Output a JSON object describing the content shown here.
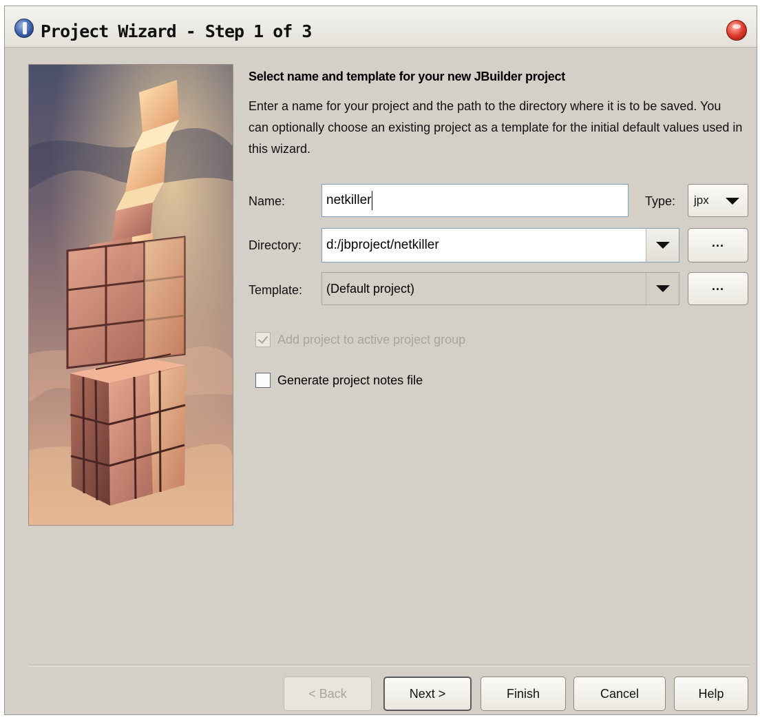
{
  "window": {
    "title": "Project Wizard - Step 1 of 3"
  },
  "icons": {
    "app": "jbuilder-icon",
    "close": "close-icon"
  },
  "heading": "Select name and template for your new JBuilder project",
  "description": "Enter a name for your project and the path to the directory where it is to be saved. You can optionally choose an existing project as a template for the initial default values used in this wizard.",
  "form": {
    "name": {
      "label": "Name:",
      "value": "netkiller"
    },
    "type": {
      "label": "Type:",
      "value": "jpx"
    },
    "directory": {
      "label": "Directory:",
      "value": "d:/jbproject/netkiller"
    },
    "template": {
      "label": "Template:",
      "value": "(Default project)"
    },
    "browse_label": "..."
  },
  "options": {
    "add_to_group": {
      "label": "Add project to active project group",
      "checked": true,
      "enabled": false
    },
    "generate_notes": {
      "label": "Generate project notes file",
      "checked": false,
      "enabled": true
    }
  },
  "buttons": {
    "back": "< Back",
    "next": "Next >",
    "finish": "Finish",
    "cancel": "Cancel",
    "help": "Help"
  },
  "colors": {
    "dialog_bg": "#d4d0c8",
    "field_border": "#7f9db9",
    "close_button": "#e03c2c"
  }
}
